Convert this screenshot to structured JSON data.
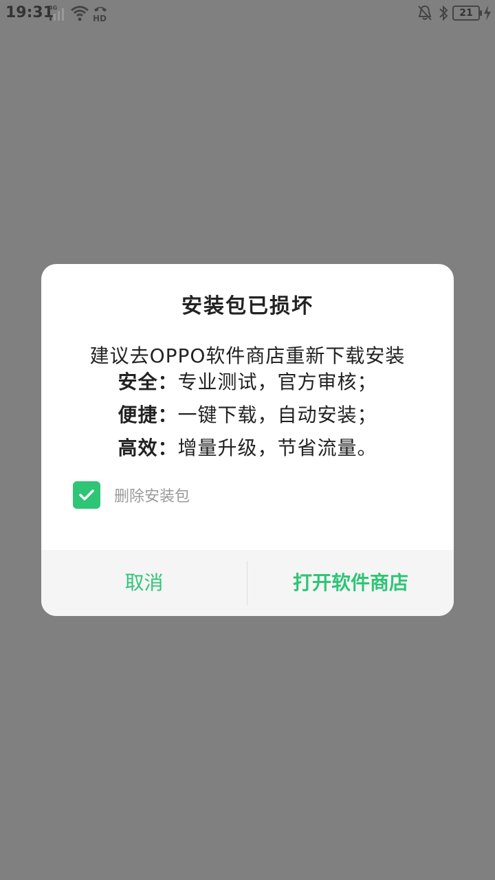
{
  "status_bar": {
    "time": "19:31",
    "network": "4G",
    "hd_label": "HD",
    "battery_level": "21",
    "icons": [
      "signal-icon",
      "wifi-icon",
      "hd-call-icon",
      "mute-icon",
      "bluetooth-icon",
      "battery-icon",
      "charging-icon"
    ]
  },
  "dialog": {
    "title": "安装包已损坏",
    "message_line1": "建议去OPPO软件商店重新下载安装",
    "features": [
      {
        "label": "安全：",
        "text": "专业测试，官方审核；"
      },
      {
        "label": "便捷：",
        "text": "一键下载，自动安装；"
      },
      {
        "label": "高效：",
        "text": "增量升级，节省流量。"
      }
    ],
    "checkbox": {
      "checked": true,
      "label": "删除安装包"
    },
    "buttons": {
      "cancel": "取消",
      "open_store": "打开软件商店"
    },
    "accent_color": "#2ec576"
  }
}
